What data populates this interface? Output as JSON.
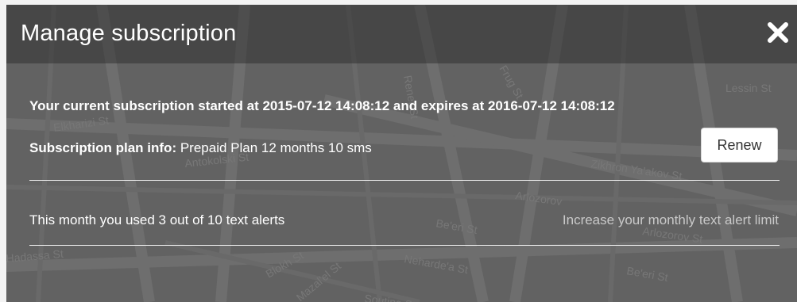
{
  "dialog": {
    "title": "Manage subscription",
    "close_icon": "close-icon"
  },
  "subscription": {
    "period_text": "Your current subscription started at 2015-07-12 14:08:12 and expires at 2016-07-12 14:08:12",
    "plan_label": "Subscription plan info:",
    "plan_value": "Prepaid Plan 12 months 10 sms",
    "renew_label": "Renew"
  },
  "usage": {
    "text": "This month you used 3 out of 10 text alerts",
    "increase_link": "Increase your monthly text alert limit"
  },
  "map_labels": {
    "lessin": "Lessin St",
    "elkharizi": "Elkharizi St",
    "antokolski": "Antokolski St",
    "zikhron": "Zikhron Ya'akov St",
    "arlozorov1": "Arlozorov",
    "arlozorov2": "Arlozorov St",
    "beeri1": "Be'eri St",
    "beeri2": "Be'eri St",
    "neharde": "Neharde'a St",
    "bloch": "Blokh St",
    "hadassa": "Hadassa St",
    "soutine": "Soutine St",
    "mazal": "Mazal'el St",
    "renger": "Rener St",
    "frug": "Frug St"
  },
  "colors": {
    "text": "#ffffff",
    "link": "#c9c9c9",
    "button_bg": "#ffffff"
  }
}
